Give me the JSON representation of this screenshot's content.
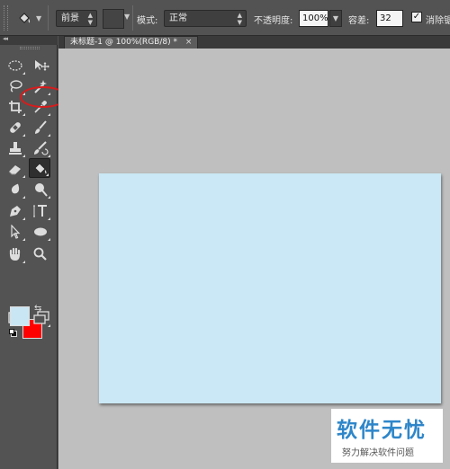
{
  "options_bar": {
    "tool_preset_icon": "paint-bucket-icon",
    "fill_source": "前景",
    "mode_label": "模式:",
    "mode_value": "正常",
    "opacity_label": "不透明度:",
    "opacity_value": "100%",
    "tolerance_label": "容差:",
    "tolerance_value": "32",
    "antialias_label": "消除锯",
    "antialias_checked": true
  },
  "toolbar": {
    "collapse_glyph": "◂◂",
    "tools": [
      {
        "name": "rectangular-marquee-tool",
        "icon": "marquee-icon"
      },
      {
        "name": "move-tool",
        "icon": "move-icon",
        "highlighted": true
      },
      {
        "name": "lasso-tool",
        "icon": "lasso-icon"
      },
      {
        "name": "magic-wand-tool",
        "icon": "magic-wand-icon"
      },
      {
        "name": "crop-tool",
        "icon": "crop-icon"
      },
      {
        "name": "eyedropper-tool",
        "icon": "eyedropper-icon"
      },
      {
        "name": "healing-brush-tool",
        "icon": "bandage-icon"
      },
      {
        "name": "brush-tool",
        "icon": "brush-icon"
      },
      {
        "name": "clone-stamp-tool",
        "icon": "stamp-icon"
      },
      {
        "name": "history-brush-tool",
        "icon": "history-brush-icon"
      },
      {
        "name": "eraser-tool",
        "icon": "eraser-icon"
      },
      {
        "name": "paint-bucket-tool",
        "icon": "paint-bucket-icon",
        "active": true
      },
      {
        "name": "blur-tool",
        "icon": "blur-icon"
      },
      {
        "name": "dodge-tool",
        "icon": "dodge-icon"
      },
      {
        "name": "pen-tool",
        "icon": "pen-icon"
      },
      {
        "name": "type-tool",
        "icon": "type-icon"
      },
      {
        "name": "path-selection-tool",
        "icon": "arrow-icon"
      },
      {
        "name": "ellipse-tool",
        "icon": "ellipse-icon"
      },
      {
        "name": "hand-tool",
        "icon": "hand-icon"
      },
      {
        "name": "zoom-tool",
        "icon": "zoom-icon"
      }
    ],
    "foreground_color": "#cae8f5",
    "background_color": "#ff0000",
    "quick_mask_icon": "quick-mask-icon",
    "screen_mode_icon": "screen-mode-icon"
  },
  "document": {
    "tab_title": "未标题-1 @ 100%(RGB/8) *",
    "tab_close": "×",
    "canvas_color": "#cae8f5"
  },
  "watermark": {
    "title": "软件无忧",
    "subtitle": "努力解决软件问题"
  }
}
